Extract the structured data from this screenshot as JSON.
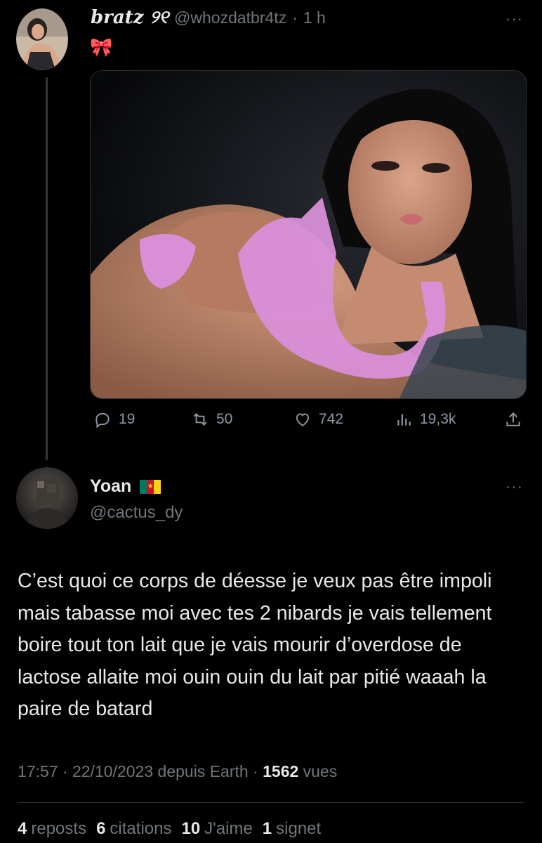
{
  "original_tweet": {
    "display_name": "bratz ୨୧",
    "handle": "@whozdatbr4tz",
    "separator": "·",
    "time": "1 h",
    "bio_emoji": "🎀",
    "more": "···",
    "actions": {
      "replies": "19",
      "reposts": "50",
      "likes": "742",
      "views": "19,3k"
    }
  },
  "reply": {
    "display_name": "Yoan",
    "flag_country": "Cameroon",
    "handle": "@cactus_dy",
    "more": "···",
    "text": "C’est quoi ce corps de déesse je veux pas être impoli mais tabasse moi avec tes 2 nibards je vais tellement boire tout ton lait que je vais mourir d’overdose de lactose allaite moi ouin ouin du lait par pitié waaah la paire de batard",
    "meta": {
      "time": "17:57",
      "sep1": " · ",
      "date": "22/10/2023",
      "source": " depuis Earth",
      "sep2": " · ",
      "views_count": "1562",
      "views_label": " vues"
    },
    "stats": [
      {
        "count": "4",
        "label": "reposts"
      },
      {
        "count": "6",
        "label": "citations"
      },
      {
        "count": "10",
        "label": "J'aime"
      },
      {
        "count": "1",
        "label": "signet"
      }
    ]
  },
  "colors": {
    "background": "#000000",
    "text": "#e7e9ea",
    "muted": "#71767b",
    "border": "#2f3336",
    "lingerie_pink": "#d98fd8"
  }
}
